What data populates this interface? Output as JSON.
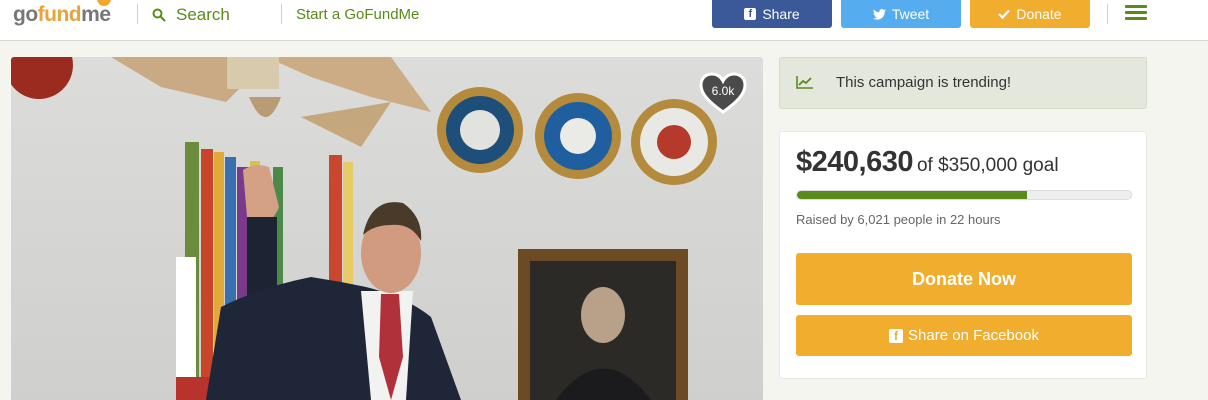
{
  "header": {
    "logo": {
      "part1": "go",
      "part2": "fund",
      "part3": "me"
    },
    "search_label": "Search",
    "start_label": "Start a GoFundMe",
    "share_label": "Share",
    "tweet_label": "Tweet",
    "donate_label": "Donate",
    "colors": {
      "green": "#5a8a1a",
      "facebook": "#3b5998",
      "twitter": "#55acee",
      "orange": "#f0ad2e"
    }
  },
  "hero": {
    "heart_count": "6.0k",
    "icons": [
      "heart-icon"
    ]
  },
  "trending": {
    "text": "This campaign is trending!",
    "icon": "trending-chart-icon"
  },
  "campaign": {
    "raised": "$240,630",
    "goal": "of $350,000 goal",
    "progress_fraction": 0.6875,
    "raised_by": "Raised by 6,021 people in 22 hours",
    "donate_now_label": "Donate Now",
    "share_facebook_label": "Share on Facebook"
  }
}
